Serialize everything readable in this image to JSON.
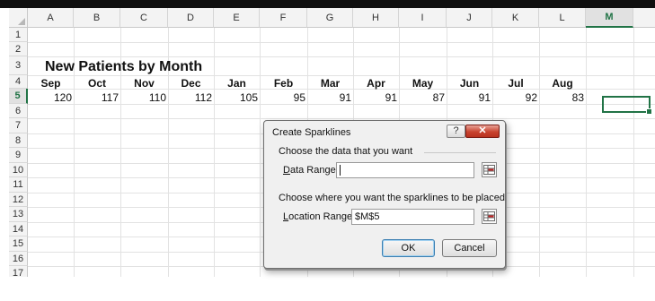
{
  "columns": [
    "A",
    "B",
    "C",
    "D",
    "E",
    "F",
    "G",
    "H",
    "I",
    "J",
    "K",
    "L",
    "M"
  ],
  "selected_column": "M",
  "rows": [
    "1",
    "2",
    "3",
    "4",
    "5",
    "6",
    "7",
    "8",
    "9",
    "10",
    "11",
    "12",
    "13",
    "14",
    "15",
    "16",
    "17"
  ],
  "selected_row": "5",
  "sheet": {
    "title": "New Patients by Month",
    "months": [
      "Sep",
      "Oct",
      "Nov",
      "Dec",
      "Jan",
      "Feb",
      "Mar",
      "Apr",
      "May",
      "Jun",
      "Jul",
      "Aug"
    ],
    "values": [
      "120",
      "117",
      "110",
      "112",
      "105",
      "95",
      "91",
      "91",
      "87",
      "91",
      "92",
      "83"
    ]
  },
  "dialog": {
    "title": "Create Sparklines",
    "help_glyph": "?",
    "close_glyph": "✕",
    "group1_label": "Choose the data that you want",
    "data_range_label_key": "D",
    "data_range_label_rest": "ata Range:",
    "data_range_value": "",
    "group2_label": "Choose where you want the sparklines to be placed",
    "location_range_label_key": "L",
    "location_range_label_rest": "ocation Range:",
    "location_range_value": "$M$5",
    "ok_label": "OK",
    "cancel_label": "Cancel"
  },
  "colors": {
    "accent": "#217346",
    "close": "#c8432f"
  }
}
